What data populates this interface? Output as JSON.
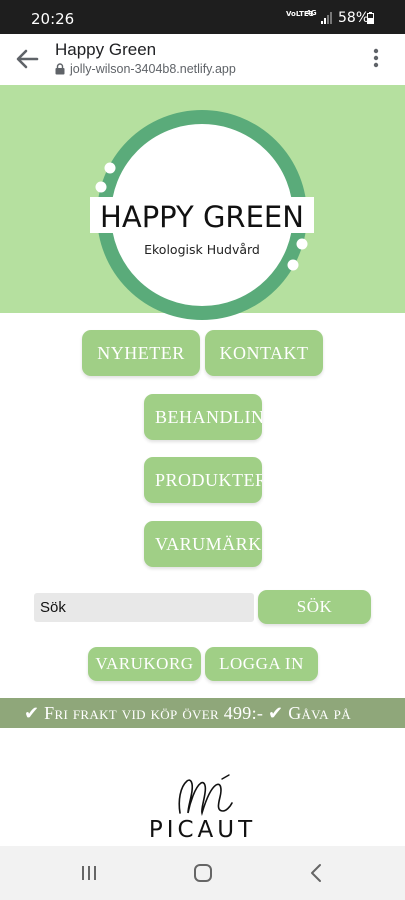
{
  "status_bar": {
    "time": "20:26",
    "network": "VoLTE1",
    "lte": "4G",
    "battery": "58%"
  },
  "browser": {
    "title": "Happy Green",
    "url": "jolly-wilson-3404b8.netlify.app"
  },
  "hero": {
    "logo_title": "HAPPY GREEN",
    "logo_subtitle": "Ekologisk Hudvård",
    "background_color": "#b5e09f",
    "ring_color": "#5aab7a"
  },
  "nav": {
    "nyheter": "Nyheter",
    "kontakt": "Kontakt",
    "behandling": "Behandlingar",
    "produkter": "Produkter",
    "varumarken": "Varumärken"
  },
  "search": {
    "placeholder": "Sök",
    "button": "Sök"
  },
  "account": {
    "cart": "Varukorg",
    "login": "Logga in"
  },
  "banner": {
    "text": "✔ Fri frakt vid köp över 499:- ✔ Gåva på"
  },
  "brand": {
    "name": "PICAUT"
  },
  "colors": {
    "button": "#a0cf86",
    "banner": "#8fa77a"
  }
}
